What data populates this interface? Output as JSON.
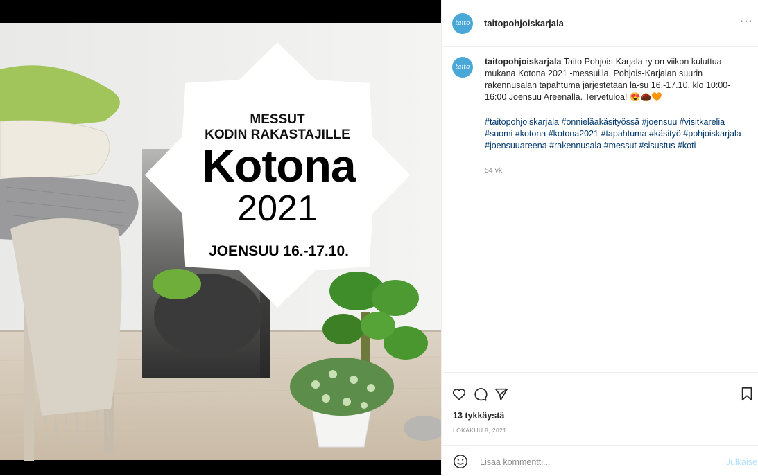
{
  "poster": {
    "line1": "MESSUT",
    "line2": "KODIN RAKASTAJILLE",
    "title": "Kotona",
    "year": "2021",
    "place_dates": "JOENSUU 16.-17.10."
  },
  "post": {
    "avatar_text": "taito",
    "username": "taitopohjoiskarjala",
    "more_label": "···",
    "caption_username": "taitopohjoiskarjala",
    "caption_text": " Taito Pohjois-Karjala ry on viikon kuluttua mukana Kotona 2021 -messuilla. Pohjois-Karjalan suurin rakennusalan tapahtuma järjestetään la-su 16.-17.10. klo 10:00-16:00 Joensuu Areenalla. Tervetuloa! 😍🌰🧡",
    "hashtags": "#taitopohjoiskarjala #onnieläakäsityössä #joensuu #visitkarelia #suomi #kotona #kotona2021 #tapahtuma #käsityö #pohjoiskarjala #joensuuareena #rakennusala #messut #sisustus #koti",
    "age": "54 vk",
    "likes": "13 tykkäystä",
    "date": "LOKAKUU 8, 2021",
    "comment_placeholder": "Lisää kommentti...",
    "publish_label": "Julkaise"
  },
  "colors": {
    "link": "#00376b",
    "muted": "#8e8e8e",
    "publish": "#b2dffc",
    "avatar": "#4aa8d8"
  },
  "icons": [
    "heart-icon",
    "comment-icon",
    "share-icon",
    "bookmark-icon",
    "emoji-icon",
    "more-icon"
  ]
}
